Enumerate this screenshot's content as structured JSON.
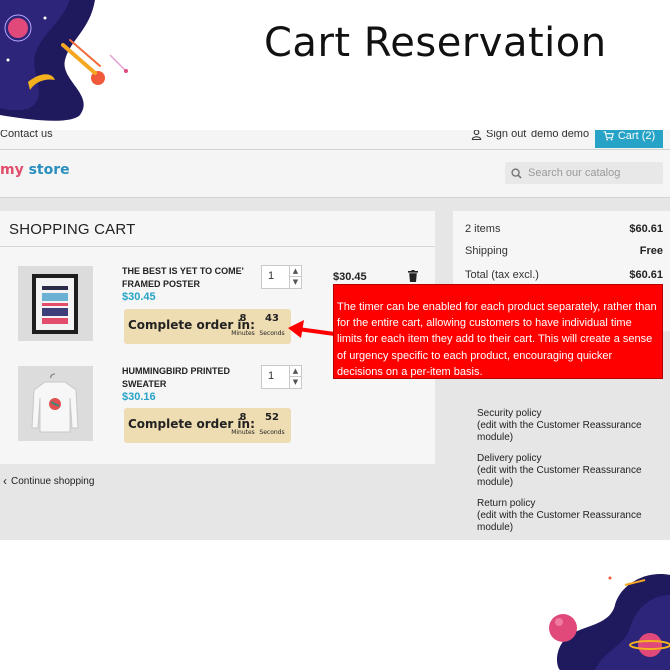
{
  "banner": {
    "title": "Cart Reservation"
  },
  "topnav": {
    "contact": "Contact us",
    "sign_out": "Sign out",
    "user": "demo demo",
    "cart": "Cart (2)"
  },
  "header": {
    "logo_a": "my",
    "logo_b": "store",
    "search_placeholder": "Search our catalog"
  },
  "cart": {
    "heading": "SHOPPING CART",
    "items": [
      {
        "name": "THE BEST IS YET TO COME' FRAMED POSTER",
        "price": "$30.45",
        "qty": "1",
        "total": "$30.45",
        "timer_label": "Complete order in:",
        "minutes": "8",
        "seconds": "43",
        "minutes_unit": "Minutes",
        "seconds_unit": "Seconds"
      },
      {
        "name": "HUMMINGBIRD PRINTED SWEATER",
        "price": "$30.16",
        "qty": "1",
        "timer_label": "Complete order in:",
        "minutes": "8",
        "seconds": "52",
        "minutes_unit": "Minutes",
        "seconds_unit": "Seconds"
      }
    ],
    "continue": "Continue shopping"
  },
  "summary": {
    "items_label": "2 items",
    "items_value": "$60.61",
    "shipping_label": "Shipping",
    "shipping_value": "Free",
    "total_label": "Total (tax excl.)",
    "total_value": "$60.61"
  },
  "reassurance": [
    {
      "title": "Security policy",
      "desc": "(edit with the Customer Reassurance module)"
    },
    {
      "title": "Delivery policy",
      "desc": "(edit with the Customer Reassurance module)"
    },
    {
      "title": "Return policy",
      "desc": "(edit with the Customer Reassurance module)"
    }
  ],
  "callout": {
    "text": "The timer can be enabled for each product separately, rather than for the entire cart, allowing customers to have individual time limits for each item they add to their cart. This will create a sense of urgency specific to each product, encouraging quicker decisions on a per-item basis."
  },
  "colors": {
    "accent": "#26a3c6",
    "timer_bg": "#eedcb2",
    "callout_bg": "#ff0000"
  }
}
